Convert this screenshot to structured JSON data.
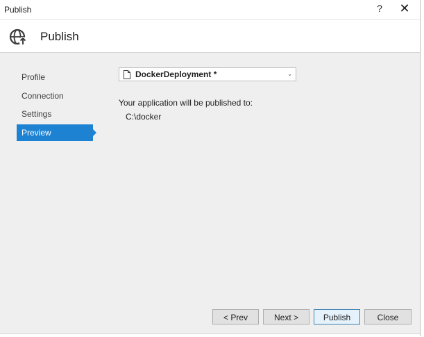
{
  "window": {
    "title": "Publish",
    "help_label": "?",
    "close_label": "✕"
  },
  "header": {
    "title": "Publish",
    "icon": "globe-publish-icon"
  },
  "nav": {
    "items": [
      {
        "label": "Profile",
        "active": false
      },
      {
        "label": "Connection",
        "active": false
      },
      {
        "label": "Settings",
        "active": false
      },
      {
        "label": "Preview",
        "active": true
      }
    ]
  },
  "profile": {
    "selected": "DockerDeployment *",
    "icon": "document-icon"
  },
  "preview": {
    "label": "Your application will be published to:",
    "path": "C:\\docker"
  },
  "buttons": {
    "prev": "< Prev",
    "next": "Next >",
    "publish": "Publish",
    "close": "Close"
  },
  "colors": {
    "accent": "#1d82d2",
    "panel_bg": "#efefef"
  }
}
